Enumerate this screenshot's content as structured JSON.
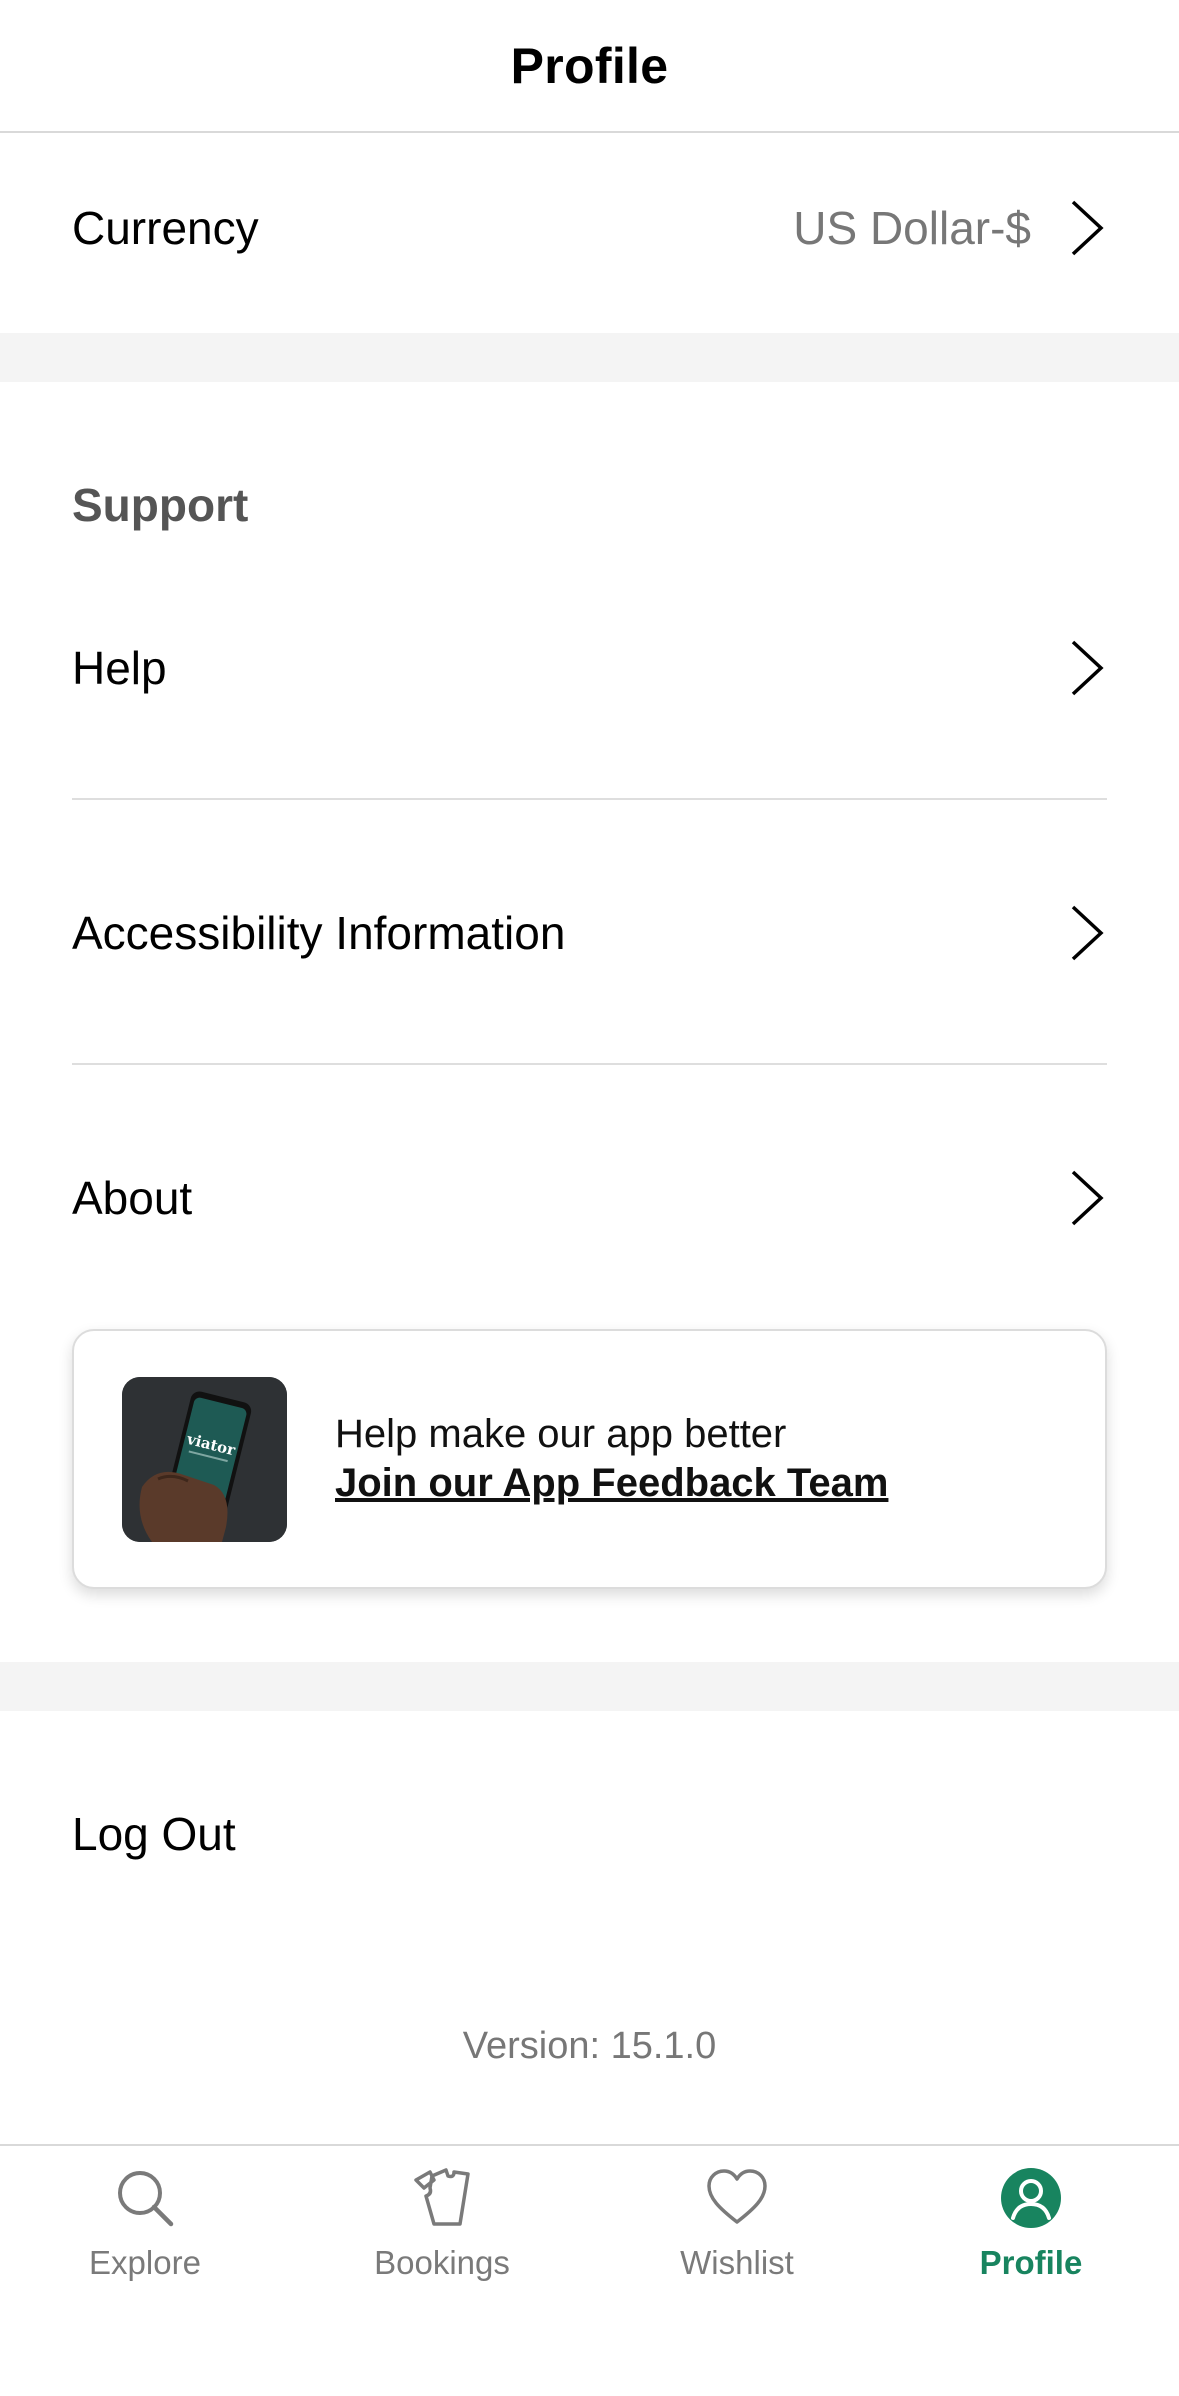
{
  "header": {
    "title": "Profile"
  },
  "currency": {
    "label": "Currency",
    "value": "US Dollar-$"
  },
  "support": {
    "title": "Support",
    "items": [
      {
        "label": "Help"
      },
      {
        "label": "Accessibility Information"
      },
      {
        "label": "About"
      }
    ]
  },
  "feedback": {
    "line1": "Help make our app better",
    "line2": "Join our App Feedback Team",
    "phone_logo": "viator"
  },
  "logout_label": "Log Out",
  "version": "Version: 15.1.0",
  "tabbar": {
    "tabs": [
      {
        "label": "Explore",
        "icon": "search-icon"
      },
      {
        "label": "Bookings",
        "icon": "tickets-icon"
      },
      {
        "label": "Wishlist",
        "icon": "heart-icon"
      },
      {
        "label": "Profile",
        "icon": "person-icon",
        "active": true
      }
    ]
  },
  "colors": {
    "accent": "#18845f",
    "band": "#f4f4f4",
    "divider": "#dedede",
    "muted_text": "#777777"
  }
}
